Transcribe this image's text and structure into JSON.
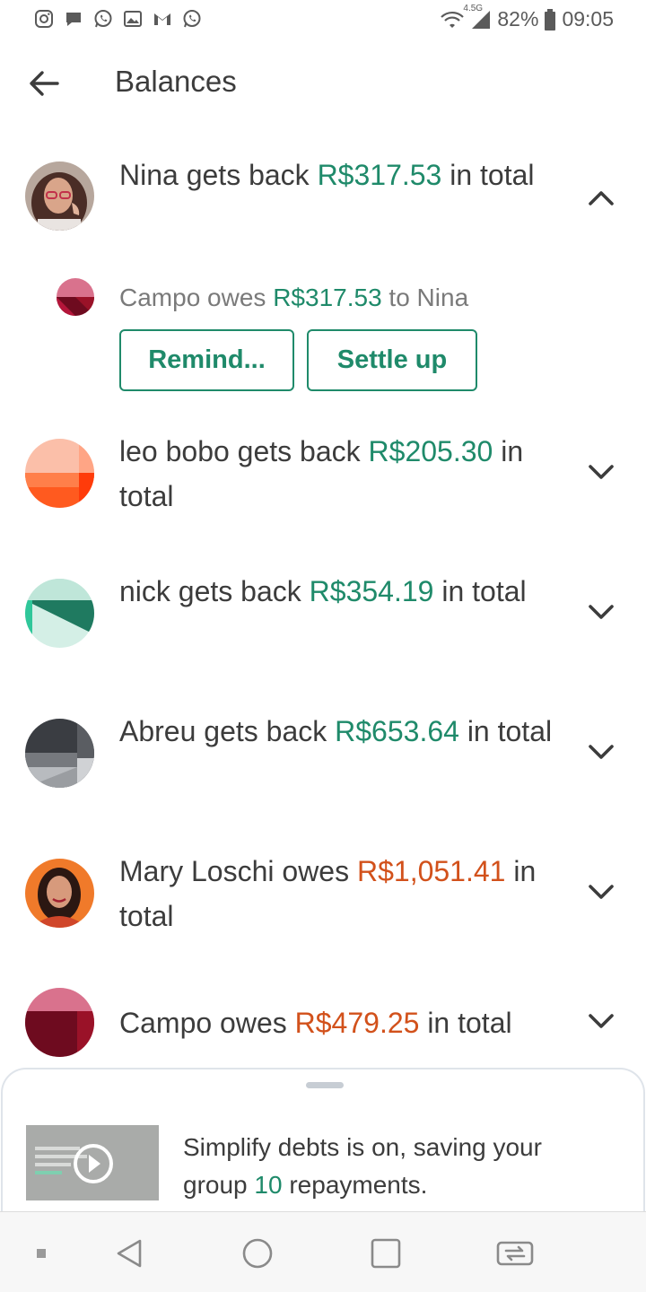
{
  "status_bar": {
    "left_icons": [
      "instagram-icon",
      "chat-bubble-icon",
      "whatsapp-icon",
      "gallery-icon",
      "gmail-icon",
      "whatsapp-icon"
    ],
    "network": "4.5G",
    "battery": "82%",
    "time": "09:05"
  },
  "app_bar": {
    "back_icon": "arrow-left-icon",
    "title": "Balances"
  },
  "balances": [
    {
      "name": "Nina",
      "verb": "gets back",
      "amount": "R$317.53",
      "suffix": "in total",
      "direction": "positive",
      "expanded": true
    },
    {
      "name": "leo bobo",
      "verb": "gets back",
      "amount": "R$205.30",
      "suffix": "in total",
      "direction": "positive",
      "expanded": false
    },
    {
      "name": "nick",
      "verb": "gets back",
      "amount": "R$354.19",
      "suffix": "in total",
      "direction": "positive",
      "expanded": false
    },
    {
      "name": "Abreu",
      "verb": "gets back",
      "amount": "R$653.64",
      "suffix": "in total",
      "direction": "positive",
      "expanded": false
    },
    {
      "name": "Mary Loschi",
      "verb": "owes",
      "amount": "R$1,051.41",
      "suffix": "in total",
      "direction": "negative",
      "expanded": false
    },
    {
      "name": "Campo",
      "verb": "owes",
      "amount": "R$479.25",
      "suffix": "in total",
      "direction": "negative",
      "expanded": false
    }
  ],
  "detail": {
    "debtor": "Campo",
    "verb": "owes",
    "amount": "R$317.53",
    "to_text": "to Nina",
    "remind_label": "Remind...",
    "settle_label": "Settle up"
  },
  "bottom_sheet": {
    "text_before": "Simplify debts is on, saving your group",
    "count": "10",
    "text_after": "repayments."
  },
  "colors": {
    "positive": "#1f8a6a",
    "negative": "#d2511b",
    "text": "#3c3c3c"
  }
}
